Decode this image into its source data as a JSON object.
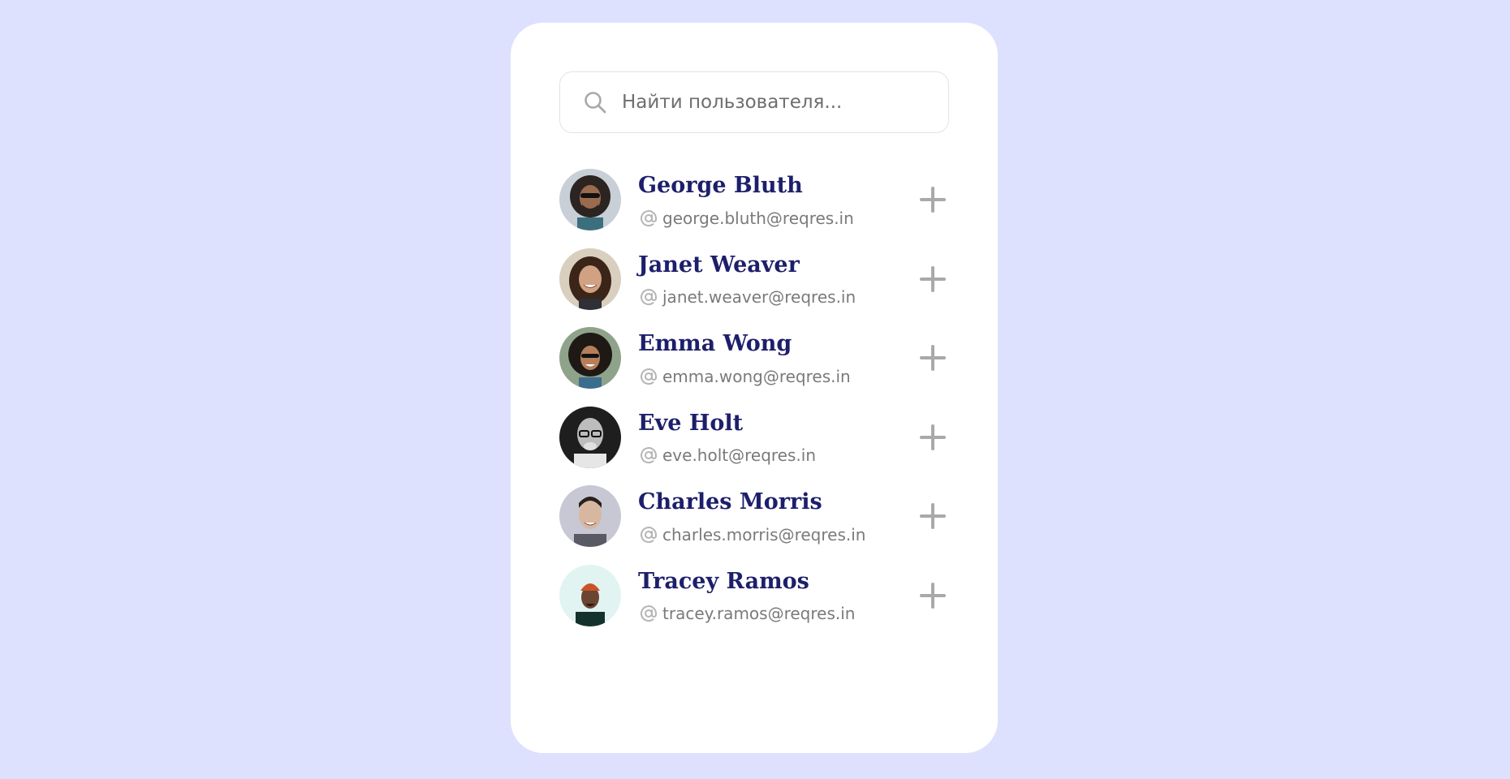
{
  "search": {
    "placeholder": "Найти пользователя...",
    "value": "",
    "icon": "search-icon"
  },
  "users": [
    {
      "name": "George Bluth",
      "email": "george.bluth@reqres.in",
      "avatar": "avatar-george-bluth"
    },
    {
      "name": "Janet Weaver",
      "email": "janet.weaver@reqres.in",
      "avatar": "avatar-janet-weaver"
    },
    {
      "name": "Emma Wong",
      "email": "emma.wong@reqres.in",
      "avatar": "avatar-emma-wong"
    },
    {
      "name": "Eve Holt",
      "email": "eve.holt@reqres.in",
      "avatar": "avatar-eve-holt"
    },
    {
      "name": "Charles Morris",
      "email": "charles.morris@reqres.in",
      "avatar": "avatar-charles-morris"
    },
    {
      "name": "Tracey Ramos",
      "email": "tracey.ramos@reqres.in",
      "avatar": "avatar-tracey-ramos"
    }
  ],
  "icons": {
    "email": "at-icon",
    "add": "plus-icon"
  },
  "colors": {
    "background": "#dde1fe",
    "card": "#ffffff",
    "name": "#1d1f6b",
    "email": "#7a7a7a",
    "icon": "#a9a9a9"
  }
}
